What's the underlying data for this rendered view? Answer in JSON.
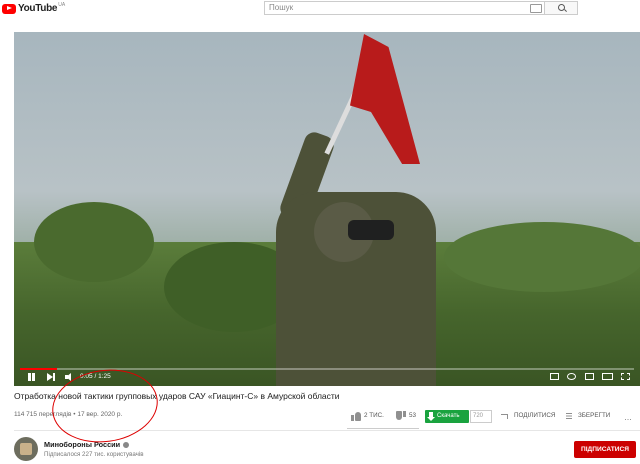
{
  "header": {
    "logo_text": "YouTube",
    "region": "UA",
    "search_placeholder": "Пошук"
  },
  "player": {
    "current_time": "0:05",
    "duration": "1:25",
    "progress_fraction": 0.06,
    "progress_color": "#ff0000"
  },
  "video": {
    "title": "Отработка новой тактики групповых ударов САУ «Гиацинт-С» в Амурской области",
    "views": "114 715 переглядів",
    "separator": "•",
    "date": "17 вер. 2020 р.",
    "likes": "2 ТИС.",
    "dislikes": "53",
    "download_label": "Скачать",
    "quality": "720",
    "share_label": "ПОДІЛИТИСЯ",
    "save_label": "ЗБЕРЕГТИ",
    "more_label": "…"
  },
  "channel": {
    "name": "Минобороны России",
    "subscribers": "Підписалося 227 тис. користувачів",
    "subscribe_label": "ПІДПИСАТИСЯ"
  },
  "colors": {
    "brand_red": "#ff0000",
    "subscribe_red": "#cc0000",
    "download_green": "#1aa33f"
  },
  "icons": [
    "youtube-logo-icon",
    "keyboard-icon",
    "search-icon",
    "pause-icon",
    "next-icon",
    "volume-icon",
    "subtitles-icon",
    "settings-icon",
    "miniplayer-icon",
    "theater-icon",
    "fullscreen-icon",
    "like-icon",
    "dislike-icon",
    "download-icon",
    "share-icon",
    "save-icon",
    "more-icon",
    "verified-icon"
  ]
}
